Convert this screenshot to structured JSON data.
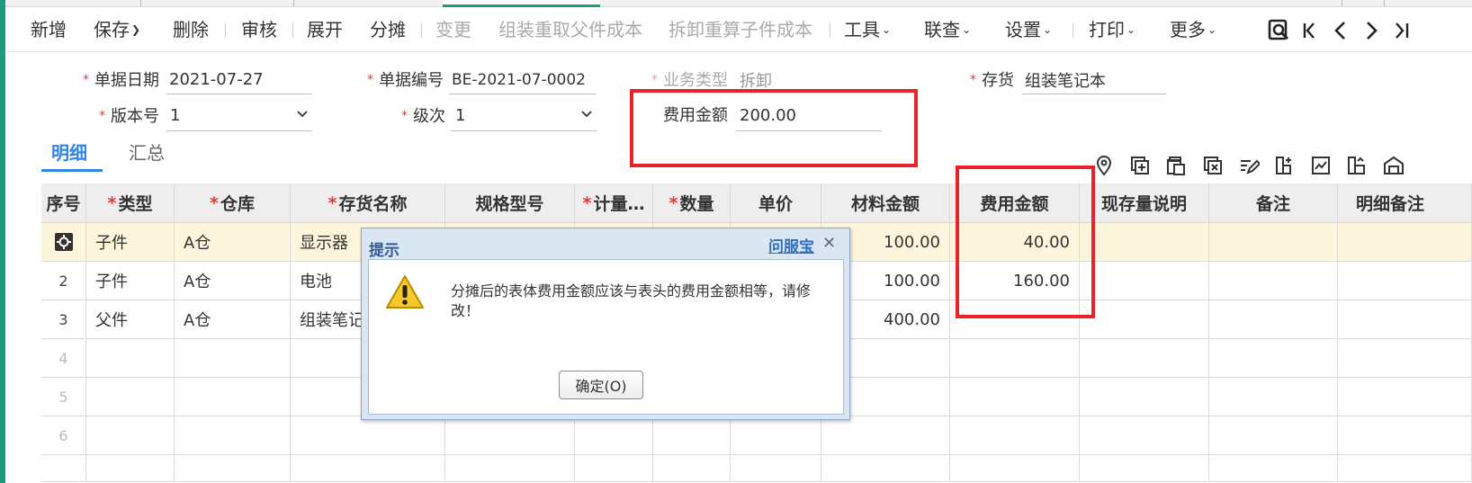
{
  "toolbar": {
    "items": [
      {
        "label": "新增"
      },
      {
        "label": "保存"
      },
      {
        "label": "删除"
      },
      {
        "label": "审核"
      },
      {
        "label": "展开"
      },
      {
        "label": "分摊"
      },
      {
        "label": "变更"
      },
      {
        "label": "组装重取父件成本"
      },
      {
        "label": "拆卸重算子件成本"
      },
      {
        "label": "工具"
      },
      {
        "label": "联查"
      },
      {
        "label": "设置"
      },
      {
        "label": "打印"
      },
      {
        "label": "更多"
      }
    ],
    "disabled_items": [
      "变更",
      "组装重取父件成本",
      "拆卸重算子件成本"
    ],
    "dropdown_items": [
      "保存",
      "工具",
      "联查",
      "设置",
      "打印",
      "更多"
    ]
  },
  "header": {
    "doc_date_label": "单据日期",
    "doc_date_value": "2021-07-27",
    "doc_no_label": "单据编号",
    "doc_no_value": "BE-2021-07-0002",
    "biz_type_label": "业务类型",
    "biz_type_value": "拆卸",
    "inventory_label": "存货",
    "inventory_value": "组装笔记本",
    "version_label": "版本号",
    "version_value": "1",
    "level_label": "级次",
    "level_value": "1",
    "fee_label": "费用金额",
    "fee_value": "200.00"
  },
  "tabs": {
    "detail": "明细",
    "summary": "汇总"
  },
  "grid": {
    "columns": [
      "序号",
      "类型",
      "仓库",
      "存货名称",
      "规格型号",
      "计量…",
      "数量",
      "单价",
      "材料金额",
      "费用金额",
      "现存量说明",
      "备注",
      "明细备注"
    ],
    "required_columns": [
      "类型",
      "仓库",
      "存货名称",
      "计量…",
      "数量"
    ],
    "rows": [
      {
        "idx": "",
        "type": "子件",
        "warehouse": "A仓",
        "name": "显示器",
        "material": "100.00",
        "fee": "40.00"
      },
      {
        "idx": "2",
        "type": "子件",
        "warehouse": "A仓",
        "name": "电池",
        "material": "100.00",
        "fee": "160.00"
      },
      {
        "idx": "3",
        "type": "父件",
        "warehouse": "A仓",
        "name": "组装笔记",
        "material": "400.00",
        "fee": ""
      },
      {
        "idx": "4",
        "type": "",
        "warehouse": "",
        "name": "",
        "material": "",
        "fee": ""
      },
      {
        "idx": "5",
        "type": "",
        "warehouse": "",
        "name": "",
        "material": "",
        "fee": ""
      },
      {
        "idx": "6",
        "type": "",
        "warehouse": "",
        "name": "",
        "material": "",
        "fee": ""
      }
    ]
  },
  "dialog": {
    "title": "提示",
    "help_link": "问服宝",
    "message": "分摊后的表体费用金额应该与表头的费用金额相等，请修改！",
    "ok_label": "确定(O)"
  },
  "colors": {
    "accent": "#2f86e6",
    "highlight_box": "#e8242a",
    "left_stripe": "#1f9a7c",
    "selected_row": "#fdf6dc"
  }
}
